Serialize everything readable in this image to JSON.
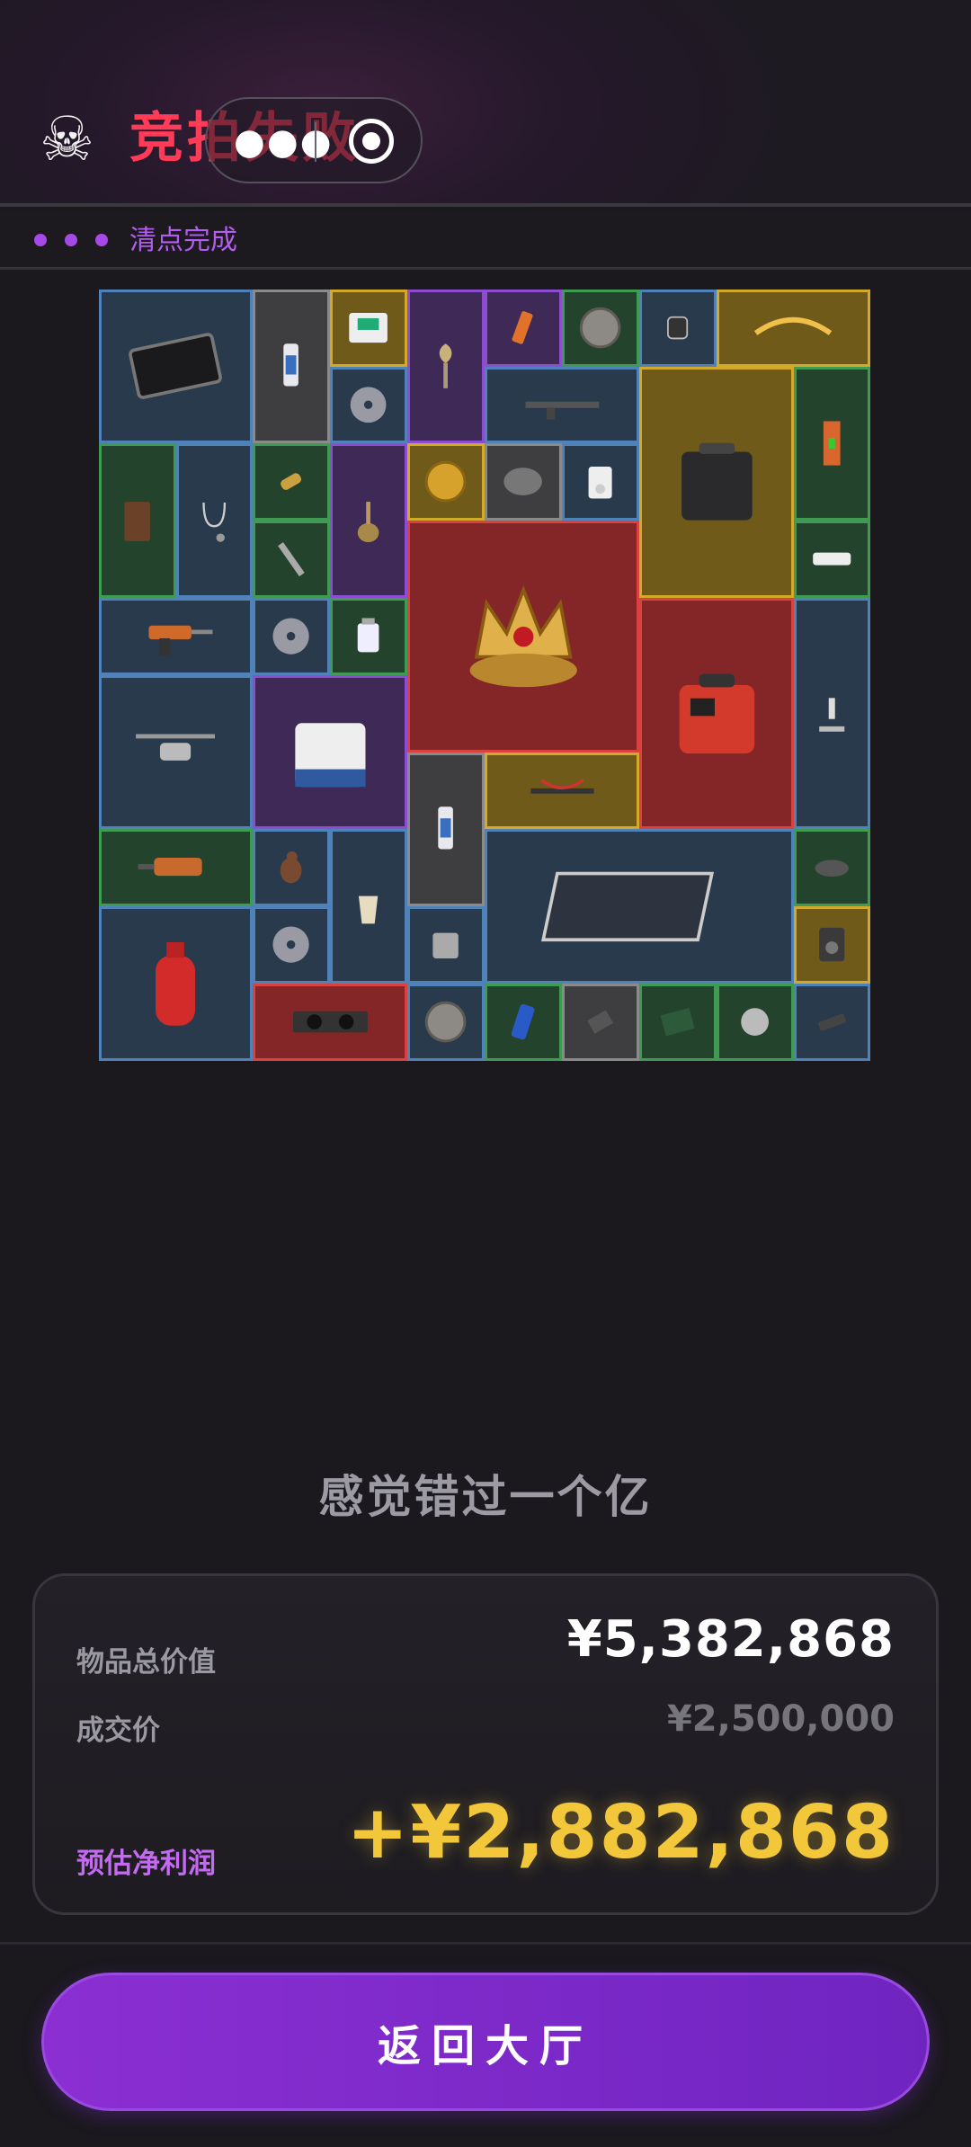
{
  "header": {
    "skull_icon": "skull-icon",
    "title": "竞拍失败",
    "capsule": {
      "more_icon": "more-dots-icon",
      "close_icon": "target-close-icon"
    }
  },
  "status": {
    "text": "清点完成",
    "dot_color": "#a748e8"
  },
  "inventory": {
    "items": [
      {
        "name": "tablet"
      },
      {
        "name": "toothpaste"
      },
      {
        "name": "smart-panel"
      },
      {
        "name": "torch-trophy"
      },
      {
        "name": "lipstick"
      },
      {
        "name": "coin"
      },
      {
        "name": "smartwatch"
      },
      {
        "name": "laurel-wreath"
      },
      {
        "name": "cd-disc"
      },
      {
        "name": "rifle"
      },
      {
        "name": "power-station"
      },
      {
        "name": "level-tool"
      },
      {
        "name": "coffee-bag"
      },
      {
        "name": "stethoscope"
      },
      {
        "name": "bullet"
      },
      {
        "name": "hookah"
      },
      {
        "name": "gold-medallion"
      },
      {
        "name": "tape-roll"
      },
      {
        "name": "music-player"
      },
      {
        "name": "wrench"
      },
      {
        "name": "jewel-crown"
      },
      {
        "name": "power-strip"
      },
      {
        "name": "power-drill"
      },
      {
        "name": "cd-disc"
      },
      {
        "name": "medicine-bottle"
      },
      {
        "name": "red-generator"
      },
      {
        "name": "microscope"
      },
      {
        "name": "drone"
      },
      {
        "name": "lab-shaker"
      },
      {
        "name": "toothpaste"
      },
      {
        "name": "crossbow"
      },
      {
        "name": "rotary-hammer"
      },
      {
        "name": "bird-figurine"
      },
      {
        "name": "moka-pot"
      },
      {
        "name": "solar-panel"
      },
      {
        "name": "eye-goggles"
      },
      {
        "name": "gas-cylinder"
      },
      {
        "name": "cd-disc"
      },
      {
        "name": "battery-block"
      },
      {
        "name": "multimeter"
      },
      {
        "name": "graphics-card"
      },
      {
        "name": "coin"
      },
      {
        "name": "drink-can"
      },
      {
        "name": "metal-part"
      },
      {
        "name": "circuit-board"
      },
      {
        "name": "speaker-horn"
      },
      {
        "name": "usb-drive"
      }
    ]
  },
  "caption": "感觉错过一个亿",
  "summary": {
    "total_label": "物品总价值",
    "total_value": "¥5,382,868",
    "price_label": "成交价",
    "price_value": "¥2,500,000",
    "profit_label": "预估净利润",
    "profit_value": "+¥2,882,868"
  },
  "actions": {
    "return_label": "返回大厅"
  },
  "colors": {
    "fail_red": "#ff3b57",
    "accent_purple": "#8b2fd2",
    "profit_gold": "#f3c73a",
    "rarity_blue": "#4f82b8",
    "rarity_green": "#3f9a52",
    "rarity_purple": "#8d4dd0",
    "rarity_gold": "#d3a92c",
    "rarity_red": "#d9423f",
    "rarity_gray": "#8a8a8a"
  }
}
